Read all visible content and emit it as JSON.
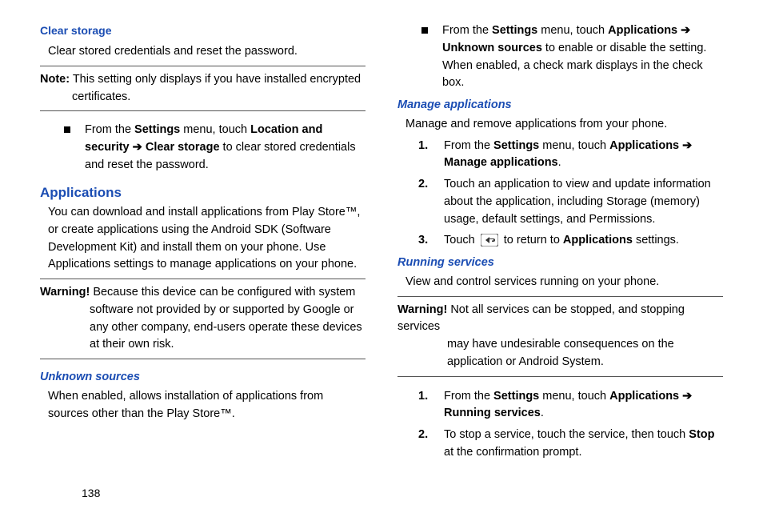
{
  "pageNumber": "138",
  "left": {
    "clearStorage": {
      "heading": "Clear storage",
      "intro": "Clear stored credentials and reset the password.",
      "noteLabel": "Note:",
      "noteLine1": " This setting only displays if you have installed encrypted",
      "noteLine2": "certificates.",
      "stepPrefix": "From the ",
      "stepBold1": "Settings",
      "stepMid1": " menu, touch ",
      "stepBold2": "Location and security",
      "arrow": " ➔ ",
      "stepBold3": "Clear storage",
      "stepTail": " to clear stored credentials and reset the password."
    },
    "applications": {
      "heading": "Applications",
      "intro": "You can download and install applications from Play Store™, or create applications using the Android SDK (Software Development Kit) and install them on your phone. Use Applications settings to manage applications on your phone.",
      "warnLabel": "Warning!",
      "warnLine1": " Because this device can be configured with system",
      "warnLine2": "software not provided by or supported by Google or any other company, end-users operate these devices at their own risk."
    },
    "unknown": {
      "heading": "Unknown sources",
      "intro": "When enabled, allows installation of applications from sources other than the Play Store™."
    }
  },
  "right": {
    "unknownStep": {
      "prefix": "From the ",
      "b1": "Settings",
      "mid1": " menu, touch ",
      "b2": "Applications",
      "arrow": " ➔ ",
      "b3": "Unknown sources",
      "tail": " to enable or disable the setting. When enabled, a check mark displays in the check box."
    },
    "manage": {
      "heading": "Manage applications",
      "intro": "Manage and remove applications from your phone.",
      "s1prefix": "From the ",
      "s1b1": "Settings",
      "s1mid": " menu, touch ",
      "s1b2": "Applications",
      "arrow": " ➔ ",
      "s1b3": "Manage applications",
      "s1tail": ".",
      "s2": "Touch an application to view and update information about the application, including Storage (memory) usage, default settings, and Permissions.",
      "s3a": "Touch ",
      "s3b": " to return to ",
      "s3bold": "Applications",
      "s3c": " settings.",
      "n1": "1.",
      "n2": "2.",
      "n3": "3."
    },
    "running": {
      "heading": "Running services",
      "intro": "View and control services running on your phone.",
      "warnLabel": "Warning!",
      "warnLine1": " Not all services can be stopped, and stopping services",
      "warnLine2": "may have undesirable consequences on the application or Android System.",
      "n1": "1.",
      "n2": "2.",
      "s1prefix": "From the ",
      "s1b1": "Settings",
      "s1mid": " menu, touch ",
      "s1b2": "Applications",
      "arrow": " ➔ ",
      "s1b3": "Running services",
      "s1tail": ".",
      "s2a": "To stop a service, touch the service, then touch ",
      "s2b": "Stop",
      "s2c": " at the confirmation prompt."
    }
  }
}
